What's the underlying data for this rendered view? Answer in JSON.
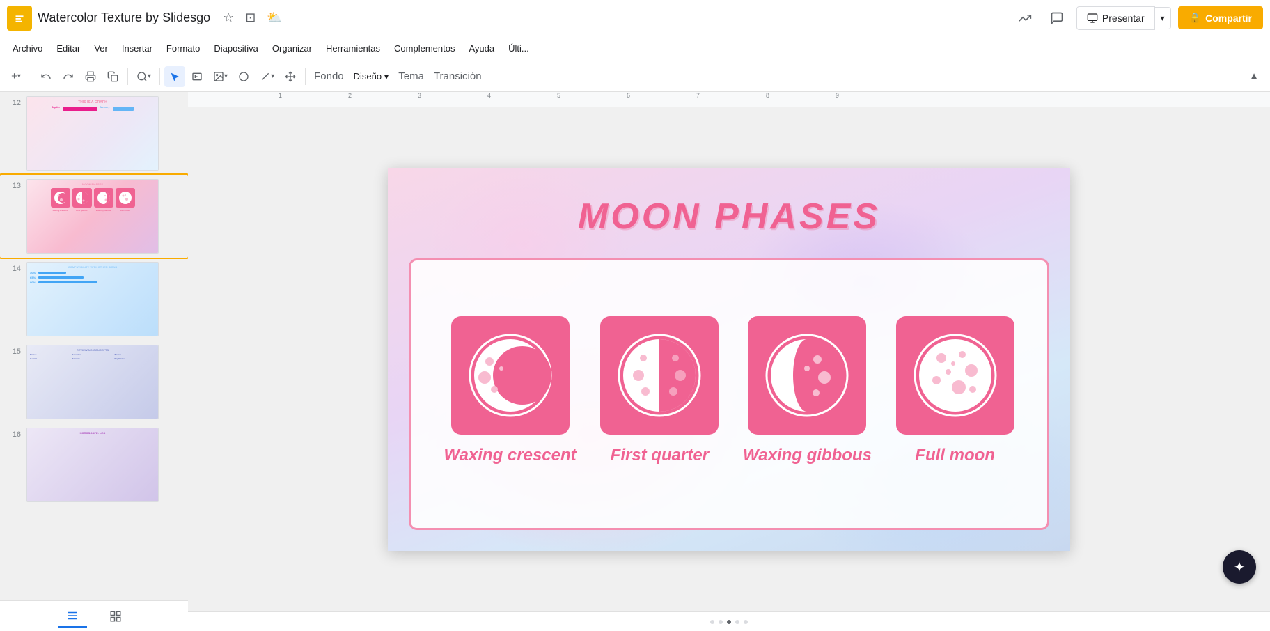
{
  "app": {
    "icon_color": "#f4b400",
    "doc_title": "Watercolor Texture by Slidesgo",
    "star_icon": "★",
    "folder_icon": "📁",
    "cloud_icon": "☁"
  },
  "topbar": {
    "trend_icon": "📈",
    "comment_icon": "💬",
    "present_label": "Presentar",
    "share_label": "Compartir",
    "share_icon": "🔒"
  },
  "menu": {
    "items": [
      "Archivo",
      "Editar",
      "Ver",
      "Insertar",
      "Formato",
      "Diapositiva",
      "Organizar",
      "Herramientas",
      "Complementos",
      "Ayuda",
      "Últi..."
    ]
  },
  "toolbar": {
    "add_label": "+",
    "undo_label": "↩",
    "redo_label": "↪",
    "print_label": "🖨",
    "clone_label": "⎘",
    "zoom_label": "🔍",
    "select_label": "↖",
    "textbox_label": "T",
    "image_label": "🖼",
    "shape_label": "⬤",
    "line_label": "╱",
    "move_label": "✛",
    "background_label": "Fondo",
    "design_label": "Diseño ▾",
    "theme_label": "Tema",
    "transition_label": "Transición",
    "collapse_label": "▲"
  },
  "slide": {
    "title": "MOON PHASES",
    "title_color": "#f06292",
    "panel_border_color": "#f48fb1",
    "moon_phases": [
      {
        "id": "waxing_crescent",
        "label": "Waxing crescent",
        "type": "crescent"
      },
      {
        "id": "first_quarter",
        "label": "First quarter",
        "type": "half"
      },
      {
        "id": "waxing_gibbous",
        "label": "Waxing gibbous",
        "type": "gibbous"
      },
      {
        "id": "full_moon",
        "label": "Full moon",
        "type": "full"
      }
    ]
  },
  "sidebar": {
    "slides": [
      {
        "num": "12",
        "type": "graph"
      },
      {
        "num": "13",
        "type": "moon_phases",
        "active": true
      },
      {
        "num": "14",
        "type": "compatibility"
      },
      {
        "num": "15",
        "type": "concepts"
      },
      {
        "num": "16",
        "type": "horoscope"
      }
    ],
    "tab_grid_label": "⊞",
    "tab_list_label": "≡"
  },
  "slide_thumbs": {
    "12": {
      "title": "THIS IS A GRAPH",
      "labels": [
        "Jupiter",
        "Mercury"
      ]
    },
    "13": {
      "title": "MOON PHASES",
      "phases": [
        "Waxing crescent",
        "First quarter",
        "Waxing gibbous",
        "Full moon"
      ]
    },
    "14": {
      "title": "COMPATIBILITY WITH OTHER SIGNS",
      "pcts": [
        "30%",
        "65%",
        "80%"
      ]
    },
    "15": {
      "title": "REVIEWING CONCEPTS",
      "cols": [
        "Pisces",
        "Aquarius",
        "Taurus",
        "Gemini",
        "Scorpio",
        "Sagittarius"
      ]
    },
    "16": {
      "title": "HOROSCOPE: LEO"
    }
  },
  "bottom_nav": {
    "dots": [
      false,
      false,
      true,
      false,
      false
    ]
  },
  "sidebar_footer": {
    "tab1_icon": "☰",
    "tab2_icon": "⊞"
  },
  "ruler": {
    "marks": [
      "1",
      "2",
      "3",
      "4",
      "5",
      "6",
      "7",
      "8",
      "9"
    ]
  },
  "ai_fab": {
    "icon": "✦"
  }
}
